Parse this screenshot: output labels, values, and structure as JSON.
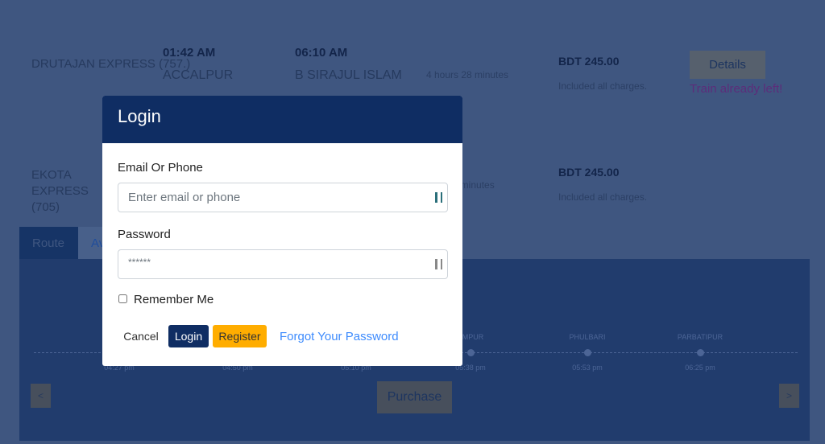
{
  "trains": [
    {
      "name": "DRUTAJAN EXPRESS (757.)",
      "dep_time": "01:42 AM",
      "dep_station": "ACCALPUR",
      "arr_time": "06:10 AM",
      "arr_station": "B SIRAJUL ISLAM",
      "duration": "4 hours 28 minutes",
      "price": "BDT 245.00",
      "price_note": "Included all charges.",
      "details_label": "Details",
      "status": "Train already left!"
    },
    {
      "name": "EKOTA EXPRESS (705)",
      "duration": "33 minutes",
      "price": "BDT 245.00",
      "price_note": "Included all charges."
    }
  ],
  "tabs": [
    {
      "label": "Route",
      "active": true
    },
    {
      "label": "Av"
    }
  ],
  "route": {
    "stations": [
      {
        "name": "",
        "time": "04:27 pm"
      },
      {
        "name": "",
        "time": "04:50 pm"
      },
      {
        "name": "",
        "time": "05:10 pm"
      },
      {
        "name": "AMPUR",
        "time": "05:38 pm"
      },
      {
        "name": "PHULBARI",
        "time": "05:53 pm"
      },
      {
        "name": "PARBATIPUR",
        "time": "06:25 pm"
      }
    ],
    "prev": "<",
    "next": ">",
    "purchase_label": "Purchase"
  },
  "modal": {
    "title": "Login",
    "email_label": "Email Or Phone",
    "email_placeholder": "Enter email or phone",
    "password_label": "Password",
    "password_value": "******",
    "remember_label": "Remember Me",
    "cancel": "Cancel",
    "login": "Login",
    "register": "Register",
    "forgot": "Forgot Your Password"
  },
  "colors": {
    "modal_header": "#0f2d63",
    "register": "#ffad00",
    "link": "#3d8bfd"
  }
}
